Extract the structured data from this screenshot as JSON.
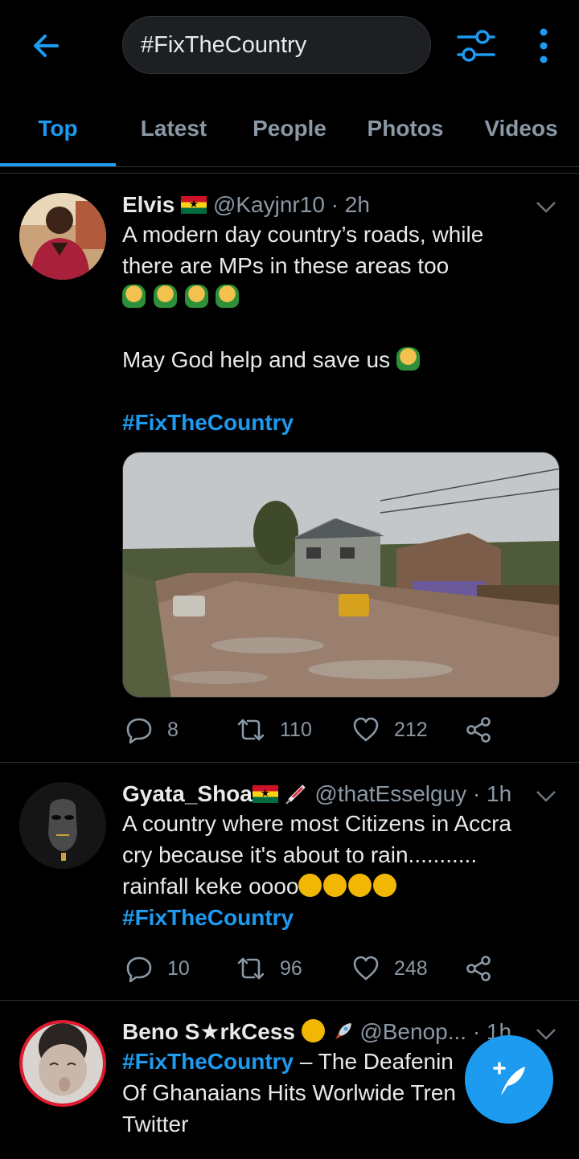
{
  "colors": {
    "accent": "#1d9bf0",
    "background": "#000000",
    "muted": "#8b98a5",
    "text": "#e7e9ea"
  },
  "search": {
    "query": "#FixTheCountry"
  },
  "tabs": [
    {
      "label": "Top",
      "active": true
    },
    {
      "label": "Latest",
      "active": false
    },
    {
      "label": "People",
      "active": false
    },
    {
      "label": "Photos",
      "active": false
    },
    {
      "label": "Videos",
      "active": false
    }
  ],
  "tweets": [
    {
      "name": "Elvis",
      "handle": "@Kayjnr10",
      "time": "· 2h",
      "text_line1": "A modern day country’s roads, while",
      "text_line2": "there are MPs in these areas too",
      "text_line3": "May God help and save us",
      "hashtag": "#FixTheCountry",
      "replies": "8",
      "retweets": "110",
      "likes": "212"
    },
    {
      "name": "Gyata_Shoa",
      "handle": "@thatEsselguy",
      "time": "· 1h",
      "text_line1": "A country where most Citizens in Accra",
      "text_line2": "cry because it's about to rain...........",
      "text_line3": "rainfall keke oooo",
      "hashtag": "#FixTheCountry",
      "replies": "10",
      "retweets": "96",
      "likes": "248"
    },
    {
      "name": "Beno S★rkCess",
      "handle": "@Benop...",
      "time": "· 1h",
      "hashtag": "#FixTheCountry",
      "text_line1": " – The Deafenin",
      "text_line2": "Of Ghanaians Hits Worlwide Tren",
      "text_line3": "Twitter"
    }
  ],
  "icons": {
    "back": "arrow-left-icon",
    "filter": "sliders-icon",
    "more": "more-vertical-icon",
    "reply": "reply-icon",
    "retweet": "retweet-icon",
    "like": "heart-icon",
    "share": "share-icon",
    "compose": "compose-tweet-icon"
  }
}
